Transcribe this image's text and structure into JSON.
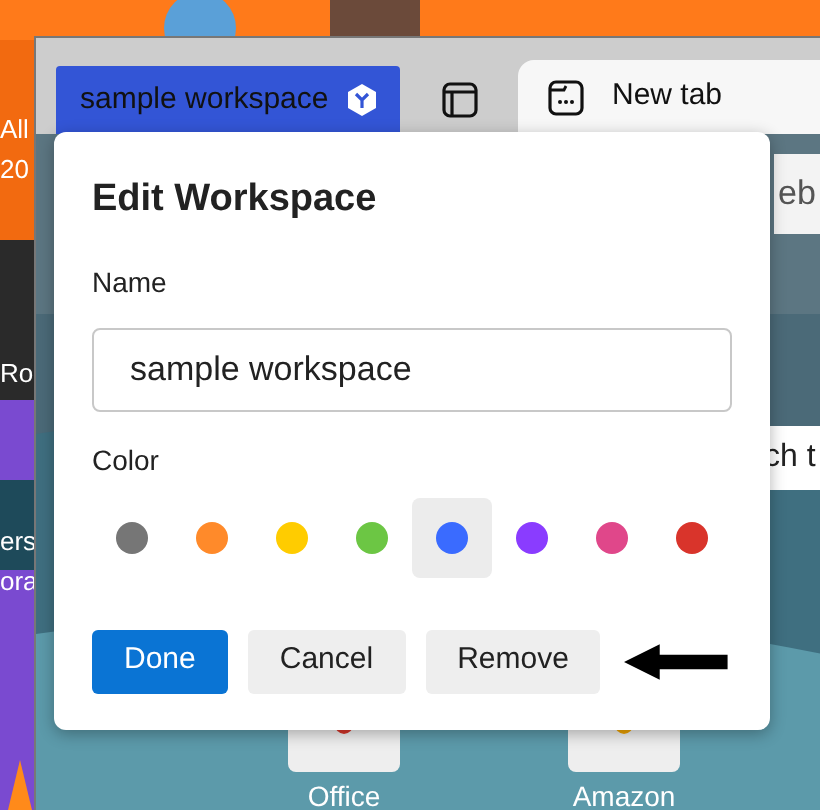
{
  "desktop_labels": [
    "All",
    "20",
    "Ro",
    "ers",
    "ora"
  ],
  "browser": {
    "workspace_button": {
      "label": "sample workspace"
    },
    "tabs": [
      {
        "label": "New tab",
        "selected": true
      }
    ],
    "address_bar": {
      "text": "eb"
    },
    "search_box": {
      "text": "ch t"
    },
    "tiles": [
      {
        "label": "Office"
      },
      {
        "label": "Amazon"
      }
    ]
  },
  "dialog": {
    "title": "Edit Workspace",
    "name_label": "Name",
    "name_value": "sample workspace",
    "color_label": "Color",
    "colors": [
      {
        "color": "#767676",
        "selected": false
      },
      {
        "color": "#ff8a2a",
        "selected": false
      },
      {
        "color": "#ffcc00",
        "selected": false
      },
      {
        "color": "#6cc644",
        "selected": false
      },
      {
        "color": "#3a6bff",
        "selected": true
      },
      {
        "color": "#8a3cff",
        "selected": false
      },
      {
        "color": "#e0478a",
        "selected": false
      },
      {
        "color": "#d9342b",
        "selected": false
      }
    ],
    "buttons": [
      {
        "label": "Done",
        "kind": "primary"
      },
      {
        "label": "Cancel",
        "kind": "secondary"
      },
      {
        "label": "Remove",
        "kind": "secondary"
      }
    ]
  }
}
